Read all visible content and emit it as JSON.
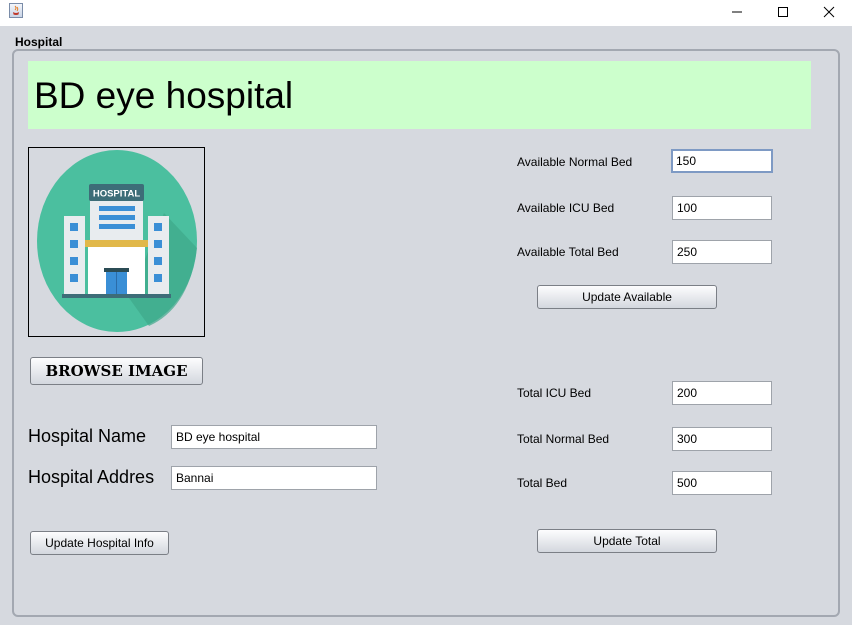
{
  "window": {
    "minimize_glyph": "—",
    "maximize_glyph": "☐",
    "close_glyph": "✕"
  },
  "frame": {
    "title": "Hospital"
  },
  "banner": {
    "title": "BD eye hospital"
  },
  "image": {
    "sign_text": "HOSPITAL",
    "colors": {
      "circle": "#4bbf9f",
      "building": "#e8ecef",
      "sign": "#3d6d78",
      "window": "#3a8fd6",
      "stripe": "#e1b84a"
    }
  },
  "buttons": {
    "browse": "BROWSE IMAGE",
    "update_info": "Update Hospital Info",
    "update_available": "Update Available",
    "update_total": "Update Total"
  },
  "hospital": {
    "name_label": "Hospital Name",
    "name_value": "BD eye hospital",
    "address_label": "Hospital Addres",
    "address_value": "Bannai"
  },
  "available": {
    "normal_label": "Available Normal Bed",
    "normal_value": "150",
    "icu_label": "Available ICU Bed",
    "icu_value": "100",
    "total_label": "Available Total Bed",
    "total_value": "250"
  },
  "totals": {
    "icu_label": "Total ICU Bed",
    "icu_value": "200",
    "normal_label": "Total Normal Bed",
    "normal_value": "300",
    "total_label": "Total Bed",
    "total_value": "500"
  }
}
